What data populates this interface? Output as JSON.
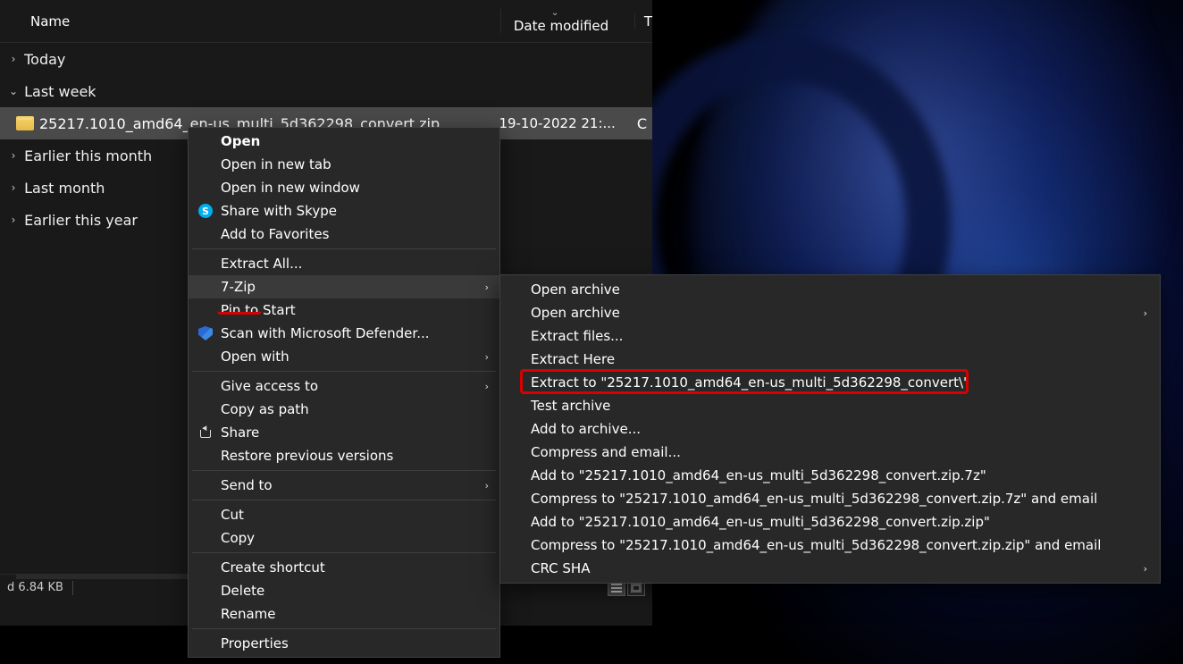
{
  "columns": {
    "name": "Name",
    "date": "Date modified",
    "type_initial": "T"
  },
  "groups": {
    "today": "Today",
    "last_week": "Last week",
    "earlier_month": "Earlier this month",
    "last_month": "Last month",
    "earlier_year": "Earlier this year"
  },
  "file": {
    "name": "25217.1010_amd64_en-us_multi_5d362298_convert.zip",
    "date": "19-10-2022 21:...",
    "type_initial": "C"
  },
  "status": {
    "size": "d  6.84 KB"
  },
  "context_menu": {
    "open": "Open",
    "open_tab": "Open in new tab",
    "open_window": "Open in new window",
    "share_skype": "Share with Skype",
    "add_fav": "Add to Favorites",
    "extract_all": "Extract All...",
    "seven_zip": "7-Zip",
    "pin_start": "Pin to Start",
    "scan_defender": "Scan with Microsoft Defender...",
    "open_with": "Open with",
    "give_access": "Give access to",
    "copy_path": "Copy as path",
    "share": "Share",
    "restore": "Restore previous versions",
    "send_to": "Send to",
    "cut": "Cut",
    "copy": "Copy",
    "create_shortcut": "Create shortcut",
    "delete": "Delete",
    "rename": "Rename",
    "properties": "Properties"
  },
  "submenu": {
    "open_archive1": "Open archive",
    "open_archive2": "Open archive",
    "extract_files": "Extract files...",
    "extract_here": "Extract Here",
    "extract_to": "Extract to \"25217.1010_amd64_en-us_multi_5d362298_convert\\\"",
    "test_archive": "Test archive",
    "add_archive": "Add to archive...",
    "compress_email": "Compress and email...",
    "add_7z": "Add to \"25217.1010_amd64_en-us_multi_5d362298_convert.zip.7z\"",
    "compress_7z_email": "Compress to \"25217.1010_amd64_en-us_multi_5d362298_convert.zip.7z\" and email",
    "add_zip": "Add to \"25217.1010_amd64_en-us_multi_5d362298_convert.zip.zip\"",
    "compress_zip_email": "Compress to \"25217.1010_amd64_en-us_multi_5d362298_convert.zip.zip\" and email",
    "crc_sha": "CRC SHA"
  }
}
